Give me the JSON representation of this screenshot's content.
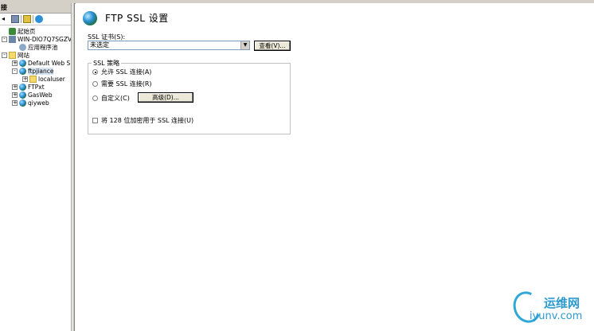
{
  "left_pane": {
    "header": "接",
    "tree": [
      {
        "label": "起始页",
        "icon": "start-page-icon",
        "expander": "",
        "indent": 0
      },
      {
        "label": "WIN-DIO7Q7SGZVN (WIN",
        "icon": "server-icon",
        "expander": "-",
        "indent": 0
      },
      {
        "label": "应用程序池",
        "icon": "app-pool-icon",
        "expander": "",
        "indent": 1
      },
      {
        "label": "网站",
        "icon": "sites-folder-icon",
        "expander": "-",
        "indent": 0
      },
      {
        "label": "Default Web S:",
        "icon": "globe-icon",
        "expander": "+",
        "indent": 1
      },
      {
        "label": "ftpjiance",
        "icon": "globe-icon",
        "expander": "-",
        "indent": 1,
        "selected": true
      },
      {
        "label": "localuser",
        "icon": "folder-icon",
        "expander": "+",
        "indent": 2
      },
      {
        "label": "FTPxt",
        "icon": "globe-icon",
        "expander": "+",
        "indent": 1
      },
      {
        "label": "GasWeb",
        "icon": "globe-icon",
        "expander": "+",
        "indent": 1
      },
      {
        "label": "qiyweb",
        "icon": "globe-icon",
        "expander": "+",
        "indent": 1
      }
    ]
  },
  "main": {
    "title": "FTP SSL 设置",
    "cert_label": "SSL 证书(S):",
    "cert_value": "未选定",
    "view_button": "查看(V)...",
    "policy_legend": "SSL 策略",
    "radio_allow": "允许 SSL 连接(A)",
    "radio_require": "需要 SSL 连接(R)",
    "radio_custom": "自定义(C)",
    "advanced_button": "高级(D)...",
    "checkbox_128": "将 128 位加密用于 SSL 连接(U)",
    "selected_policy": "allow"
  },
  "watermark": {
    "cn": "运维网",
    "en": "iyunv.com"
  },
  "colors": {
    "watermark": "#2d9ad0",
    "chrome": "#d4d0c8",
    "input_border": "#7f9db9"
  }
}
